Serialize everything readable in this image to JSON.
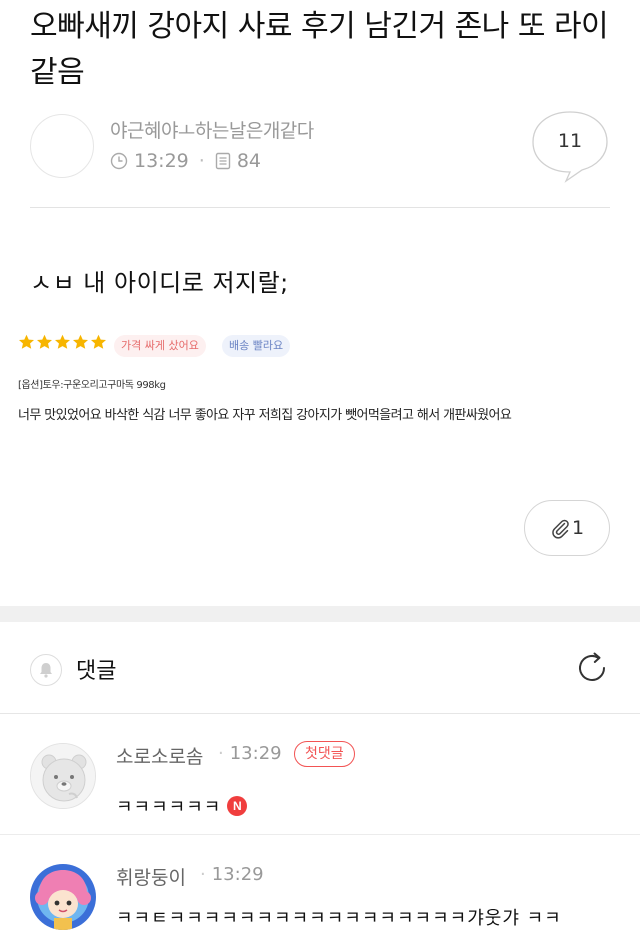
{
  "post": {
    "title": "오빠새끼 강아지 사료 후기 남긴거 존나 또 라이같음",
    "author": "야근혜야ㅗ하는날은개같다",
    "time": "13:29",
    "views": "84",
    "comment_count": "11",
    "body": "ㅅㅂ 내 아이디로 저지랄;",
    "attachment_count": "1"
  },
  "review": {
    "stars": 5,
    "tags": [
      "가격 싸게 샀어요",
      "배송 빨라요"
    ],
    "option": "[옵션]토우:구운오리고구마독 998kg",
    "text": "너무 맛있었어요 바삭한 식감 너무 좋아요 자꾸 저희집 강아지가 뺏어먹을려고 해서 개판싸웠어요"
  },
  "comments_section": {
    "label": "댓글"
  },
  "comments": [
    {
      "author": "소로소로솜",
      "time": "13:29",
      "badge": "첫댓글",
      "text": "ㅋㅋㅋㅋㅋㅋ",
      "new_badge": "N"
    },
    {
      "author": "휘랑둥이",
      "time": "13:29",
      "text": "ㅋㅋㅌㅋㅋㅋㅋㅋㅋㅋㅋㅋㅋㅋㅋㅋㅋㅋㅋㅋ갸웃갸 ㅋㅋ"
    }
  ],
  "colors": {
    "accent_red": "#f25454",
    "star": "#f7b500",
    "muted": "#999999"
  },
  "icons": [
    "clock-icon",
    "document-icon",
    "speech-bubble-icon",
    "paperclip-icon",
    "bell-icon",
    "refresh-icon",
    "star-icon"
  ]
}
